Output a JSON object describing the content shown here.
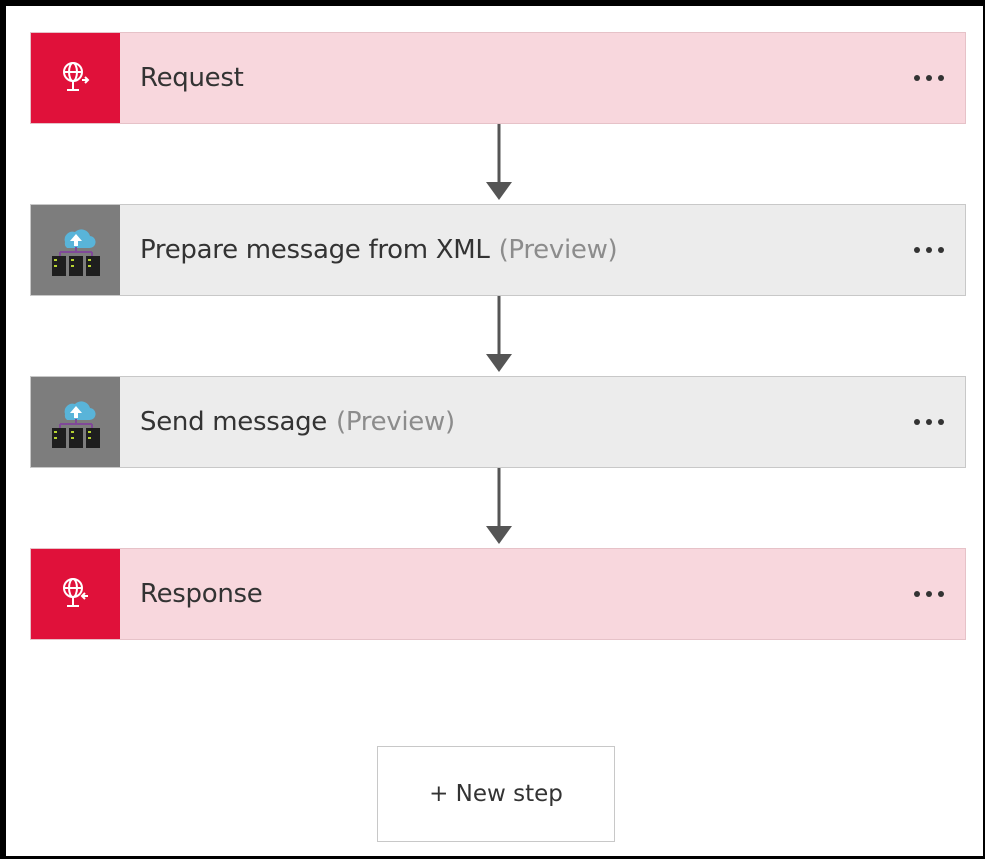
{
  "flow": {
    "steps": [
      {
        "title": "Request",
        "suffix": "",
        "icon": "http-request-icon",
        "color": "#e0113a"
      },
      {
        "title": "Prepare message from XML",
        "suffix": "(Preview)",
        "icon": "integration-account-icon",
        "color": "#7d7d7d"
      },
      {
        "title": "Send message",
        "suffix": "(Preview)",
        "icon": "integration-account-icon",
        "color": "#7d7d7d"
      },
      {
        "title": "Response",
        "suffix": "",
        "icon": "http-response-icon",
        "color": "#e0113a"
      }
    ],
    "new_step_label": "+ New step"
  }
}
